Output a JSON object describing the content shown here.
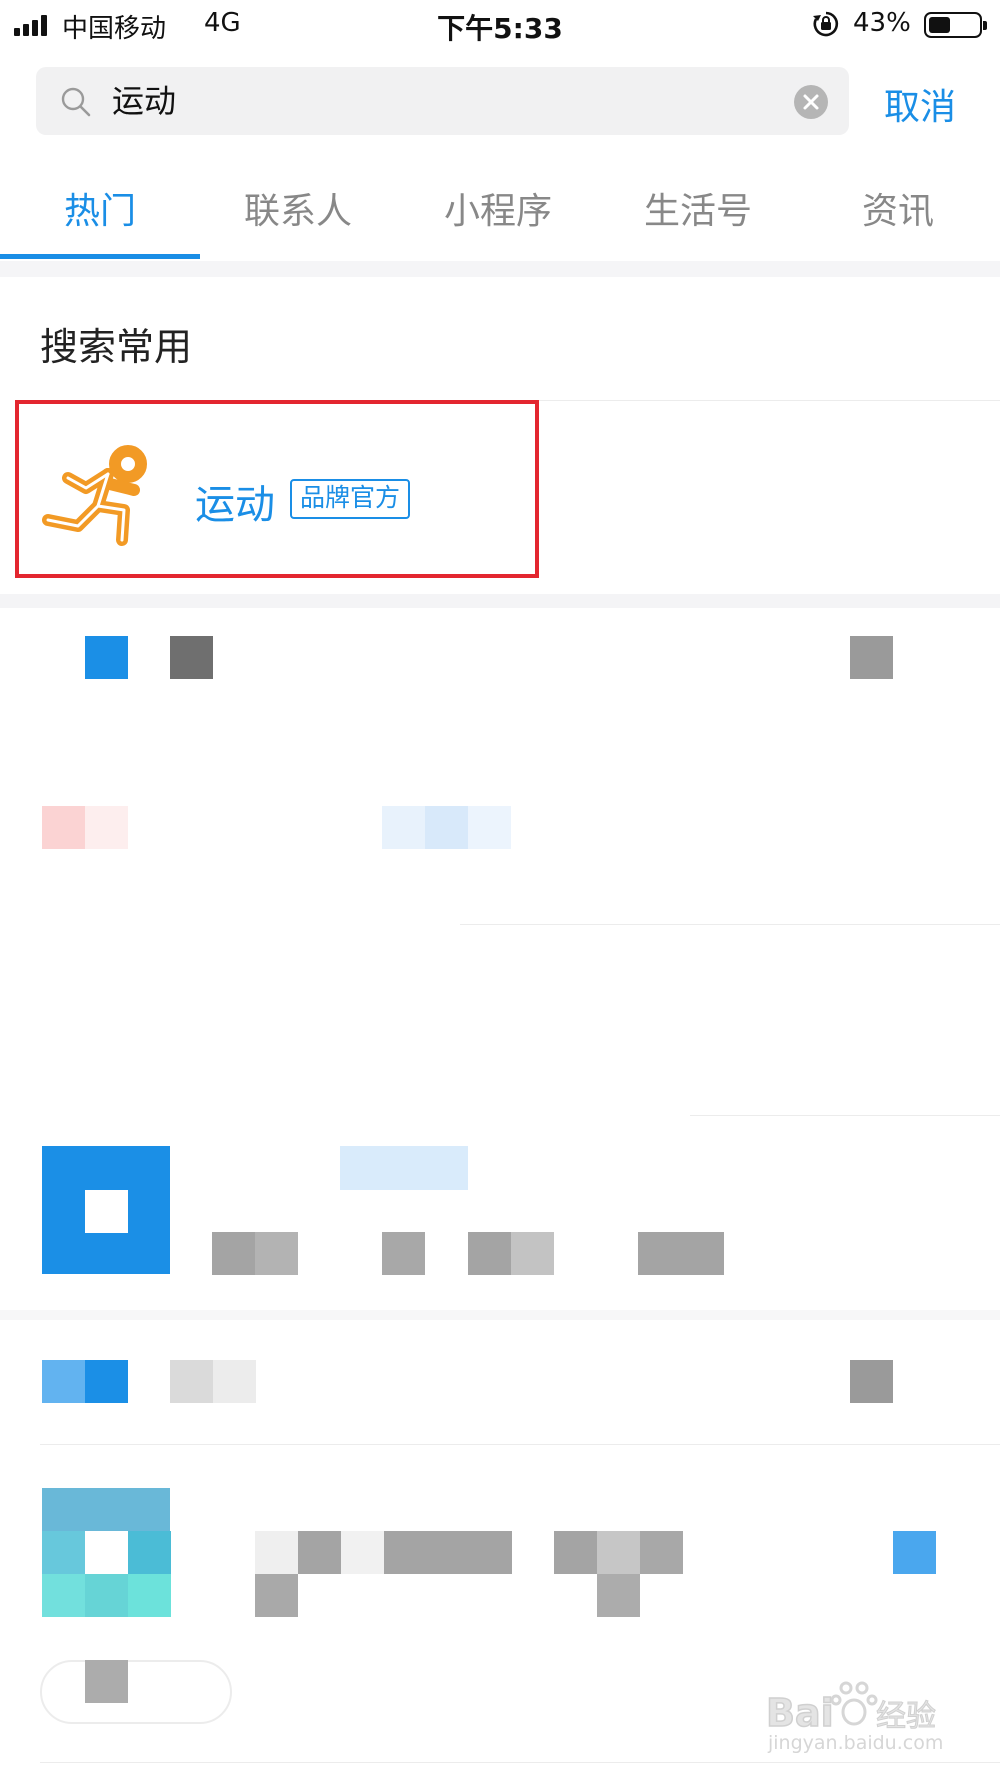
{
  "status_bar": {
    "carrier": "中国移动",
    "network": "4G",
    "time": "下午5:33",
    "battery": "43%",
    "battery_level": 0.43
  },
  "search": {
    "query": "运动",
    "cancel_label": "取消"
  },
  "tabs": [
    {
      "label": "热门",
      "active": true
    },
    {
      "label": "联系人",
      "active": false
    },
    {
      "label": "小程序",
      "active": false
    },
    {
      "label": "生活号",
      "active": false
    },
    {
      "label": "资讯",
      "active": false
    }
  ],
  "section": {
    "title": "搜索常用"
  },
  "result": {
    "app_name": "运动",
    "badge": "品牌官方"
  },
  "watermark": {
    "text": "jingyan.baidu.com"
  },
  "colors": {
    "accent": "#1a8ee6",
    "highlight_border": "#e3262f",
    "logo_orange": "#f29a25"
  }
}
